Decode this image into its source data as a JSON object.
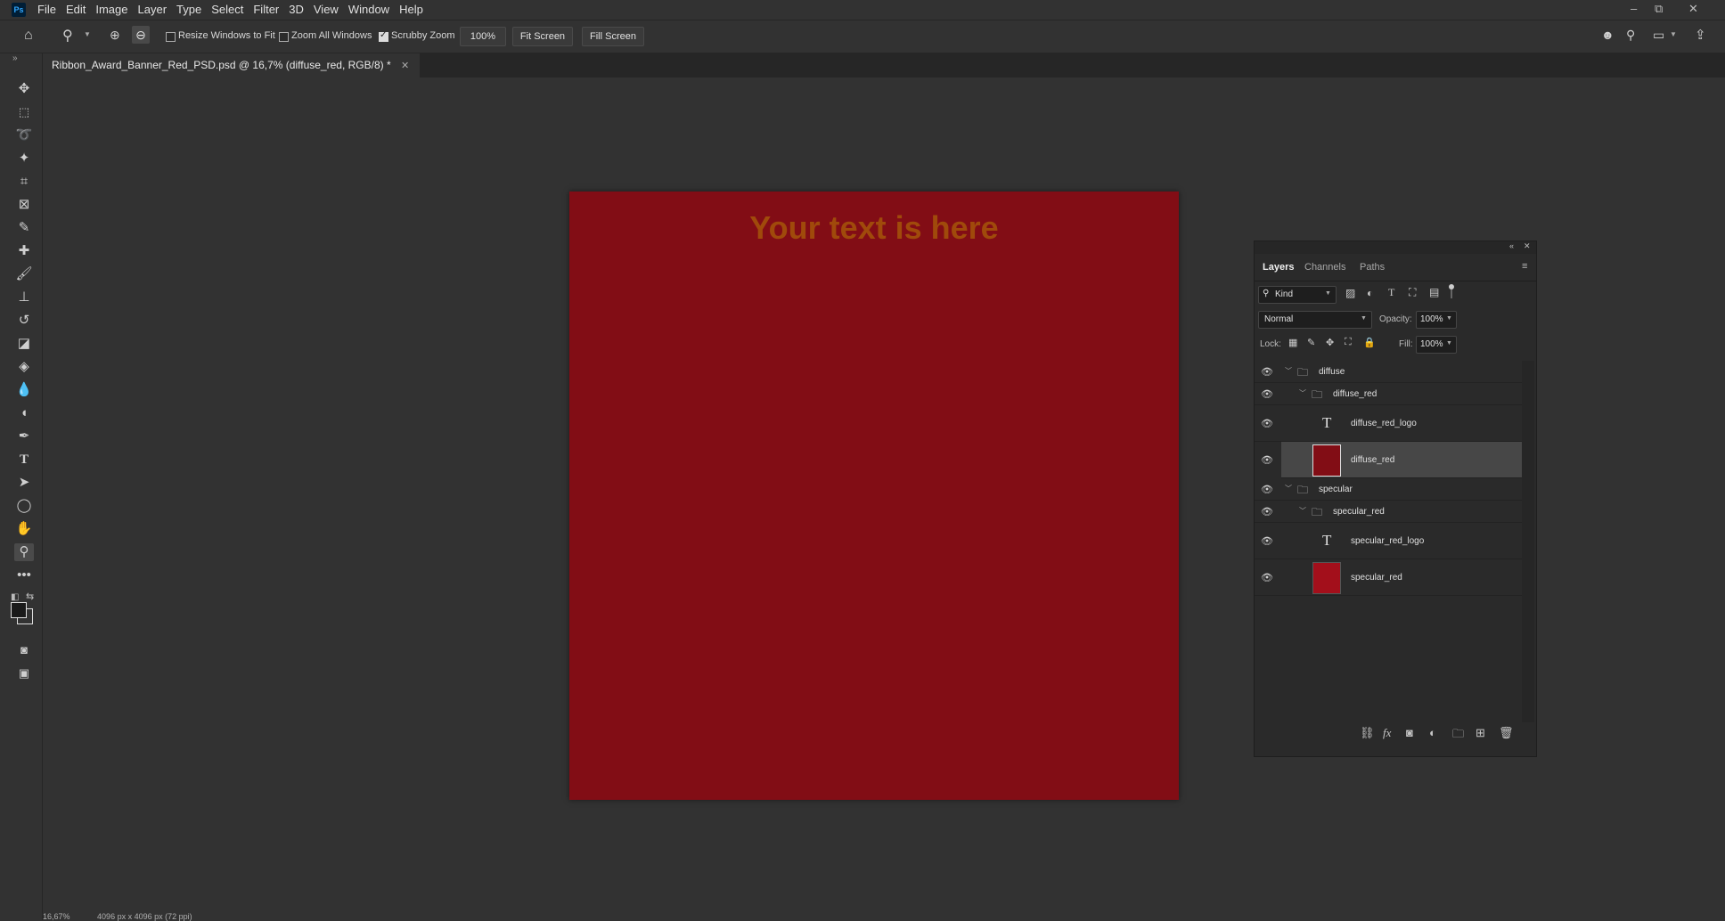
{
  "app": {
    "logo": "Ps"
  },
  "menu": [
    "File",
    "Edit",
    "Image",
    "Layer",
    "Type",
    "Select",
    "Filter",
    "3D",
    "View",
    "Window",
    "Help"
  ],
  "window_controls": {
    "minimize": "–",
    "restore": "⧉",
    "close": "✕"
  },
  "options": {
    "resize_windows_label": "Resize Windows to Fit",
    "resize_windows_checked": false,
    "zoom_all_label": "Zoom All Windows",
    "zoom_all_checked": false,
    "scrubby_zoom_label": "Scrubby Zoom",
    "scrubby_zoom_checked": true,
    "zoom_100_label": "100%",
    "fit_screen_label": "Fit Screen",
    "fill_screen_label": "Fill Screen"
  },
  "document": {
    "tab_title": "Ribbon_Award_Banner_Red_PSD.psd @ 16,7% (diffuse_red, RGB/8) *",
    "canvas_text": "Your text is here",
    "canvas_color": "#820d15",
    "text_color": "#a04a0b"
  },
  "status": {
    "zoom": "16,67%",
    "size": "4096 px x 4096 px (72 ppi)"
  },
  "layers_panel": {
    "tabs": [
      "Layers",
      "Channels",
      "Paths"
    ],
    "active_tab": "Layers",
    "filter_kind": "Kind",
    "blend_mode": "Normal",
    "opacity_label": "Opacity:",
    "opacity_value": "100%",
    "lock_label": "Lock:",
    "fill_label": "Fill:",
    "fill_value": "100%",
    "layers": [
      {
        "name": "diffuse",
        "type": "group",
        "indent": 0
      },
      {
        "name": "diffuse_red",
        "type": "group",
        "indent": 1
      },
      {
        "name": "diffuse_red_logo",
        "type": "text",
        "indent": 2
      },
      {
        "name": "diffuse_red",
        "type": "fill",
        "color": "#820d15",
        "selected": true
      },
      {
        "name": "specular",
        "type": "group",
        "indent": 0
      },
      {
        "name": "specular_red",
        "type": "group",
        "indent": 1
      },
      {
        "name": "specular_red_logo",
        "type": "text",
        "indent": 2
      },
      {
        "name": "specular_red",
        "type": "fill",
        "color": "#a30f1b"
      }
    ]
  }
}
